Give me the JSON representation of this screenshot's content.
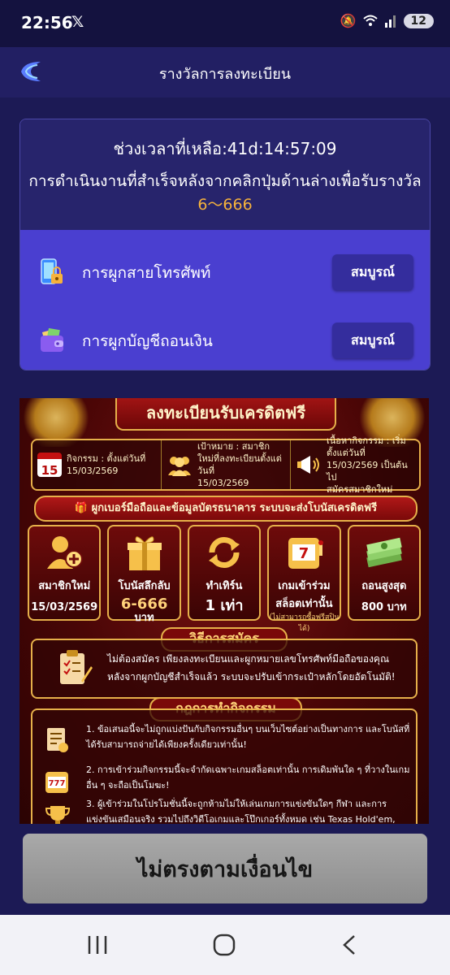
{
  "status_bar": {
    "time": "22:56",
    "app_icon": "x-logo-icon",
    "battery": "12"
  },
  "header": {
    "title": "รางวัลการลงทะเบียน"
  },
  "reward_card": {
    "countdown": "ช่วงเวลาที่เหลือ:41d:14:57:09",
    "description": "การดำเนินงานที่สำเร็จหลังจากคลิกปุ่มด้านล่างเพื่อรับรางวัล",
    "range": "6〜666",
    "tasks": [
      {
        "label": "การผูกสายโทรศัพท์",
        "button": "สมบูรณ์",
        "icon": "phone-lock-icon"
      },
      {
        "label": "การผูกบัญชีถอนเงิน",
        "button": "สมบูรณ์",
        "icon": "wallet-icon"
      }
    ]
  },
  "banner": {
    "title": "ลงทะเบียนรับเครดิตฟรี",
    "info": [
      {
        "icon": "calendar-icon",
        "day": "15",
        "line1": "กิจกรรม : ตั้งแต่วันที่",
        "line2": "15/03/2569"
      },
      {
        "icon": "people-icon",
        "line1": "เป้าหมาย : สมาชิกใหม่ที่ลงทะเบียนตั้งแต่วันที่",
        "line2": "15/03/2569"
      },
      {
        "icon": "megaphone-icon",
        "line1": "เนื้อหากิจกรรม : เริ่มตั้งแต่วันที่ 15/03/2569 เป็นต้นไป",
        "line2": "สมัครสมาชิกใหม่"
      }
    ],
    "gift_bar": "ผูกเบอร์มือถือและข้อมูลบัตรธนาคาร ระบบจะส่งโบนัสเครดิตฟรี",
    "stats": [
      {
        "icon": "add-user-icon",
        "label": "สมาชิกใหม่",
        "value": "15/03/2569",
        "unit": "",
        "sub": ""
      },
      {
        "icon": "gift-icon",
        "label": "โบนัสลึกลับ",
        "value": "6-666",
        "unit": "บาท",
        "sub": ""
      },
      {
        "icon": "refresh-icon",
        "label": "ทำเทิร์น",
        "value": "1 เท่า",
        "unit": "",
        "sub": ""
      },
      {
        "icon": "slot-icon",
        "label": "เกมเข้าร่วม",
        "value": "สล็อตเท่านั้น",
        "unit": "",
        "sub": "(ไม่สามารถซื้อฟรีสปินได้)"
      },
      {
        "icon": "cash-icon",
        "label": "ถอนสูงสุด",
        "value": "800 บาท",
        "unit": "",
        "sub": ""
      }
    ],
    "apply_title": "วิธีการสมัคร",
    "apply_text": "ไม่ต้องสมัคร เพียงลงทะเบียนและผูกหมายเลขโทรศัพท์มือถือของคุณ หลังจากผูกบัญชีสำเร็จแล้ว ระบบจะปรับเข้ากระเป๋าหลักโดยอัตโนมัติ!",
    "rules_title": "กฎการทำกิจกรรม",
    "rules": [
      "1. ข้อเสนอนี้จะไม่ถูกแบ่งปันกับกิจกรรมอื่นๆ บนเว็บไซต์อย่างเป็นทางการ และโบนัสที่ได้รับสามารถจ่ายได้เพียงครั้งเดียวเท่านั้น!",
      "2. การเข้าร่วมกิจกรรมนี้จะจำกัดเฉพาะเกมสล็อตเท่านั้น การเดิมพันใด ๆ ที่วางในเกมอื่น ๆ จะถือเป็นโมฆะ!",
      "3. ผู้เข้าร่วมในโปรโมชั่นนี้จะถูกห้ามไม่ให้เล่นเกมการแข่งขันใดๆ กีฬา และการแข่งขันเสมือนจริง รวมไปถึงวิดีโอเกมและโป๊กเกอร์ทั้งหมด เช่น Texas Hold'em, Dragon Tiger, Thirteen Water, Niu Niu, Landlord, Golden Flower, Red and Black War, Sic Bo, Lottery, เกม"
    ]
  },
  "cta": {
    "label": "ไม่ตรงตามเงื่อนไข"
  },
  "nav": {
    "recent": "recent-apps-icon",
    "home": "home-icon",
    "back": "back-icon"
  }
}
